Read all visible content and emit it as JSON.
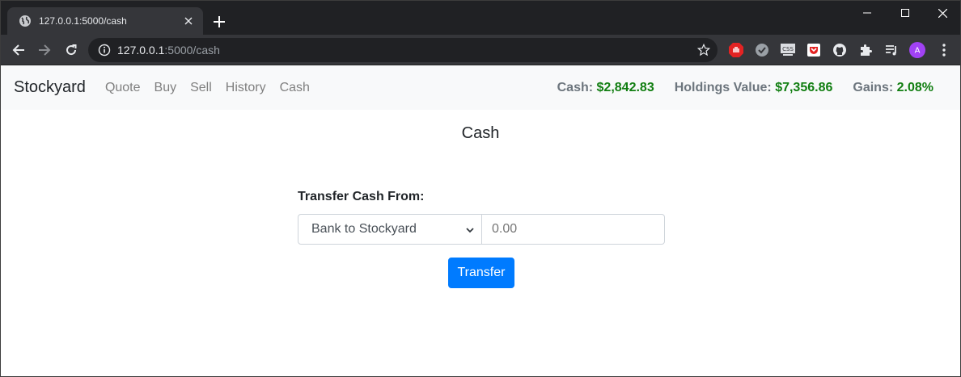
{
  "browser": {
    "tab_title": "127.0.0.1:5000/cash",
    "url_host": "127.0.0.1",
    "url_path": ":5000/cash",
    "profile_initial": "A",
    "extension_badge": "CSS"
  },
  "navbar": {
    "brand": "Stockyard",
    "links": [
      "Quote",
      "Buy",
      "Sell",
      "History",
      "Cash"
    ],
    "cash_label": "Cash:",
    "cash_value": "$2,842.83",
    "holdings_label": "Holdings Value:",
    "holdings_value": "$7,356.86",
    "gains_label": "Gains:",
    "gains_value": "2.08%"
  },
  "page": {
    "title": "Cash",
    "form_label": "Transfer Cash From:",
    "direction_selected": "Bank to Stockyard",
    "amount_placeholder": "0.00",
    "submit_label": "Transfer"
  },
  "colors": {
    "gain_green": "#117e11",
    "primary_blue": "#007bff",
    "navbar_bg": "#f8f9fa"
  }
}
